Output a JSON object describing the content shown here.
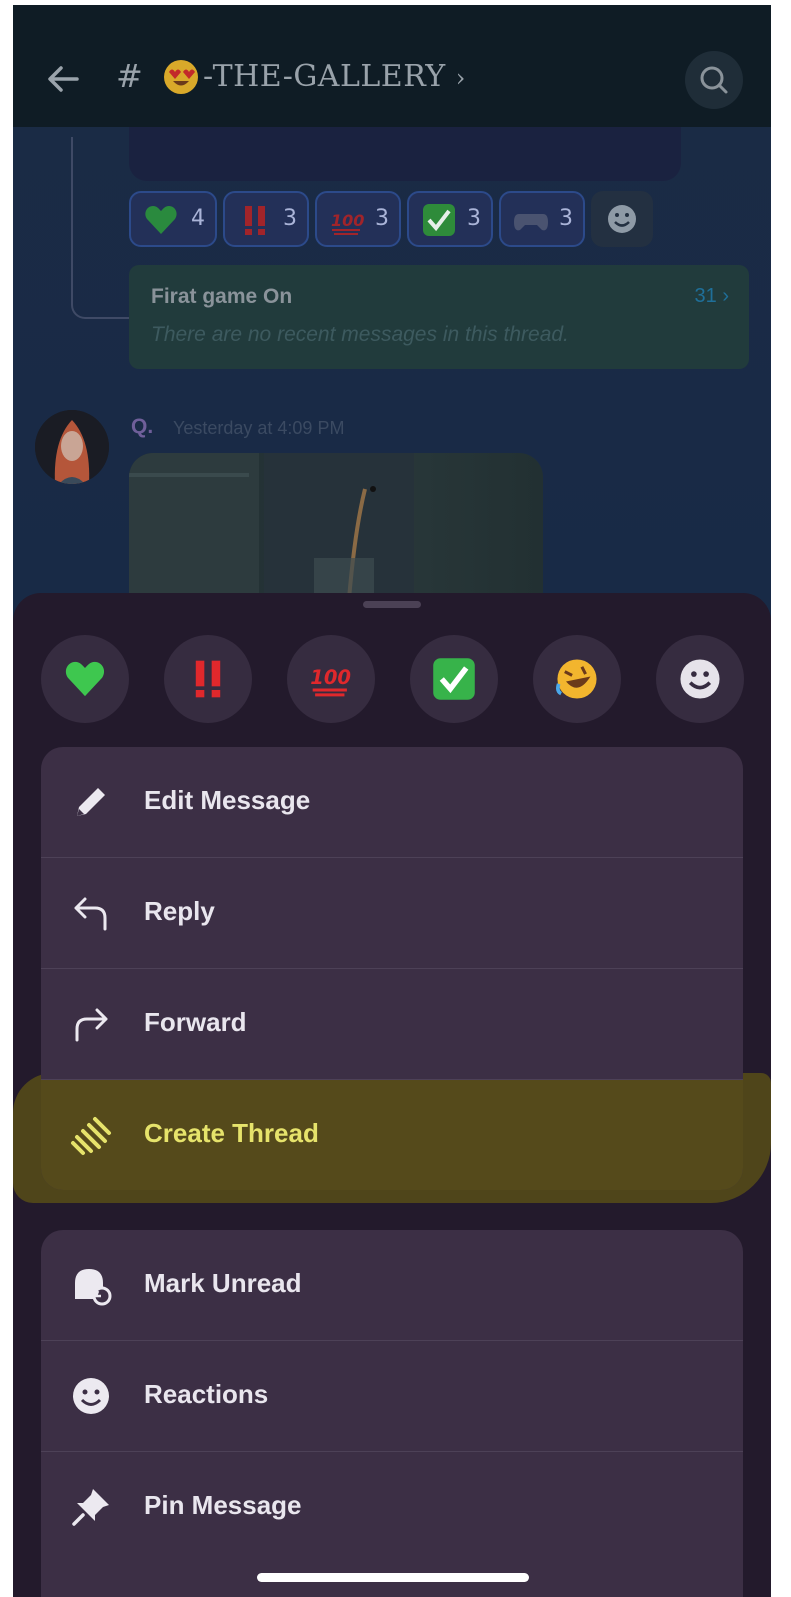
{
  "header": {
    "hash": "#",
    "title": "-THE-GALLERY",
    "chevron": "›"
  },
  "reactions": [
    {
      "emoji": "green-heart",
      "count": "4"
    },
    {
      "emoji": "double-exclamation",
      "count": "3"
    },
    {
      "emoji": "hundred-points",
      "count": "3"
    },
    {
      "emoji": "check-mark-button",
      "count": "3"
    },
    {
      "emoji": "game-controller",
      "count": "3"
    }
  ],
  "thread": {
    "title": "Firat game On",
    "count": "31",
    "subtitle": "There are no recent messages in this thread."
  },
  "message": {
    "author": "Q.",
    "time": "Yesterday at 4:09 PM"
  },
  "quick_reactions": [
    "green-heart",
    "double-exclamation",
    "hundred-points",
    "check-mark-button",
    "rofl",
    "add-reaction"
  ],
  "menu": {
    "group1": [
      {
        "label": "Edit Message",
        "icon": "pencil-icon"
      },
      {
        "label": "Reply",
        "icon": "reply-icon"
      },
      {
        "label": "Forward",
        "icon": "forward-icon"
      },
      {
        "label": "Create Thread",
        "icon": "thread-icon",
        "highlighted": true
      }
    ],
    "group2": [
      {
        "label": "Mark Unread",
        "icon": "mark-unread-icon"
      },
      {
        "label": "Reactions",
        "icon": "smiley-icon"
      },
      {
        "label": "Pin Message",
        "icon": "pin-icon"
      }
    ]
  },
  "colors": {
    "highlight": "#e6e36b",
    "sheet": "#231a2c",
    "row": "#3c2f45"
  }
}
